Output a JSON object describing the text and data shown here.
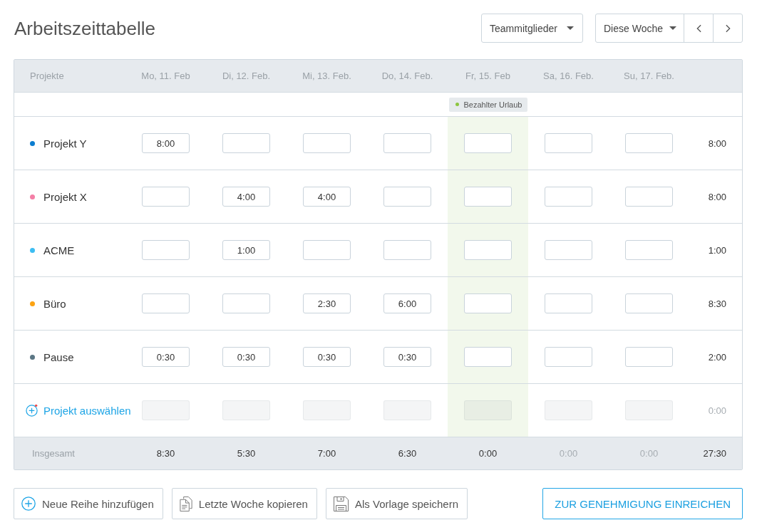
{
  "title": "Arbeitszeittabelle",
  "toolbar": {
    "team_filter": "Teammitglieder",
    "period_picker": "Diese Woche"
  },
  "table": {
    "project_header": "Projekte",
    "days": [
      {
        "label": "Mo, 11. Feb",
        "highlighted": false
      },
      {
        "label": "Di, 12. Feb.",
        "highlighted": false
      },
      {
        "label": "Mi, 13. Feb.",
        "highlighted": false
      },
      {
        "label": "Do, 14. Feb.",
        "highlighted": false
      },
      {
        "label": "Fr, 15. Feb",
        "highlighted": true,
        "badge": "Bezahlter Urlaub"
      },
      {
        "label": "Sa, 16. Feb.",
        "highlighted": false
      },
      {
        "label": "Su, 17. Feb.",
        "highlighted": false
      }
    ],
    "rows": [
      {
        "name": "Projekt Y",
        "color": "#0b7dd0",
        "hours": {
          "mon": "8:00"
        },
        "total": "8:00"
      },
      {
        "name": "Projekt X",
        "color": "#f47fa6",
        "hours": {
          "tue": "4:00",
          "wed": "4:00"
        },
        "total": "8:00"
      },
      {
        "name": "ACME",
        "color": "#3dbdf2",
        "hours": {
          "tue": "1:00"
        },
        "total": "1:00"
      },
      {
        "name": "Büro",
        "color": "#fca312",
        "hours": {
          "wed": "2:30",
          "thu": "6:00"
        },
        "total": "8:30"
      },
      {
        "name": "Pause",
        "color": "#5b7684",
        "hours": {
          "mon": "0:30",
          "tue": "0:30",
          "wed": "0:30",
          "thu": "0:30"
        },
        "total": "2:00"
      }
    ],
    "add_row": {
      "label": "Projekt auswählen",
      "disabled": true,
      "total": "0:00"
    },
    "totals": {
      "label": "Insgesamt",
      "values": [
        {
          "value": "8:30",
          "muted": false
        },
        {
          "value": "5:30",
          "muted": false
        },
        {
          "value": "7:00",
          "muted": false
        },
        {
          "value": "6:30",
          "muted": false
        },
        {
          "value": "0:00",
          "muted": false
        },
        {
          "value": "0:00",
          "muted": true
        },
        {
          "value": "0:00",
          "muted": true
        }
      ],
      "grand_total": "27:30"
    }
  },
  "actions": [
    {
      "label": "Neue Reihe hinzufügen",
      "kind": "add"
    },
    {
      "label": "Letzte Woche kopieren",
      "kind": "copy"
    },
    {
      "label": "Als Vorlage speichern",
      "kind": "save"
    }
  ],
  "submit": "ZUR GENEHMIGUNG EINREICHEN"
}
